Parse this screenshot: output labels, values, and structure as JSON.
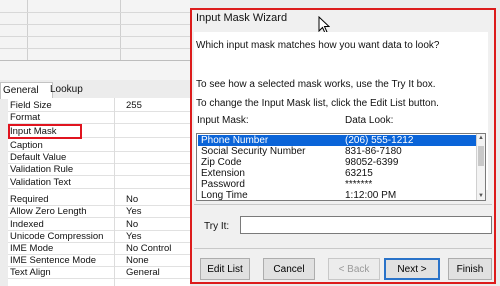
{
  "field_properties": {
    "tabs": [
      {
        "label": "General"
      },
      {
        "label": "Lookup"
      }
    ],
    "top_value": "255",
    "rows": [
      {
        "name": "Field Size",
        "value": "255"
      },
      {
        "name": "Format",
        "value": ""
      },
      {
        "name": "Input Mask",
        "value": ""
      },
      {
        "name": "Caption",
        "value": ""
      },
      {
        "name": "Default Value",
        "value": ""
      },
      {
        "name": "Validation Rule",
        "value": ""
      },
      {
        "name": "Validation Text",
        "value": ""
      },
      {
        "name": "Required",
        "value": "No"
      },
      {
        "name": "Allow Zero Length",
        "value": "Yes"
      },
      {
        "name": "Indexed",
        "value": "No"
      },
      {
        "name": "Unicode Compression",
        "value": "Yes"
      },
      {
        "name": "IME Mode",
        "value": "No Control"
      },
      {
        "name": "IME Sentence Mode",
        "value": "None"
      },
      {
        "name": "Text Align",
        "value": "General"
      }
    ],
    "highlight_color": "#e0141f"
  },
  "wizard": {
    "title": "Input Mask Wizard",
    "question": "Which input mask matches how you want data to look?",
    "instruction_try": "To see how a selected mask works, use the Try It box.",
    "instruction_edit": "To change the Input Mask list, click the Edit List button.",
    "col_input_mask": "Input Mask:",
    "col_data_look": "Data Look:",
    "masks": [
      {
        "name": "Phone Number",
        "look": "(206) 555-1212",
        "selected": true
      },
      {
        "name": "Social Security Number",
        "look": "831-86-7180",
        "selected": false
      },
      {
        "name": "Zip Code",
        "look": "98052-6399",
        "selected": false
      },
      {
        "name": "Extension",
        "look": "63215",
        "selected": false
      },
      {
        "name": "Password",
        "look": "*******",
        "selected": false
      },
      {
        "name": "Long Time",
        "look": "1:12:00 PM",
        "selected": false
      }
    ],
    "try_it_label": "Try It:",
    "try_it_value": "",
    "buttons": {
      "edit_list": "Edit List",
      "cancel": "Cancel",
      "back": "< Back",
      "next": "Next >",
      "finish": "Finish"
    },
    "selection_color": "#0a64d8",
    "outline_color": "#dc1c1c"
  }
}
